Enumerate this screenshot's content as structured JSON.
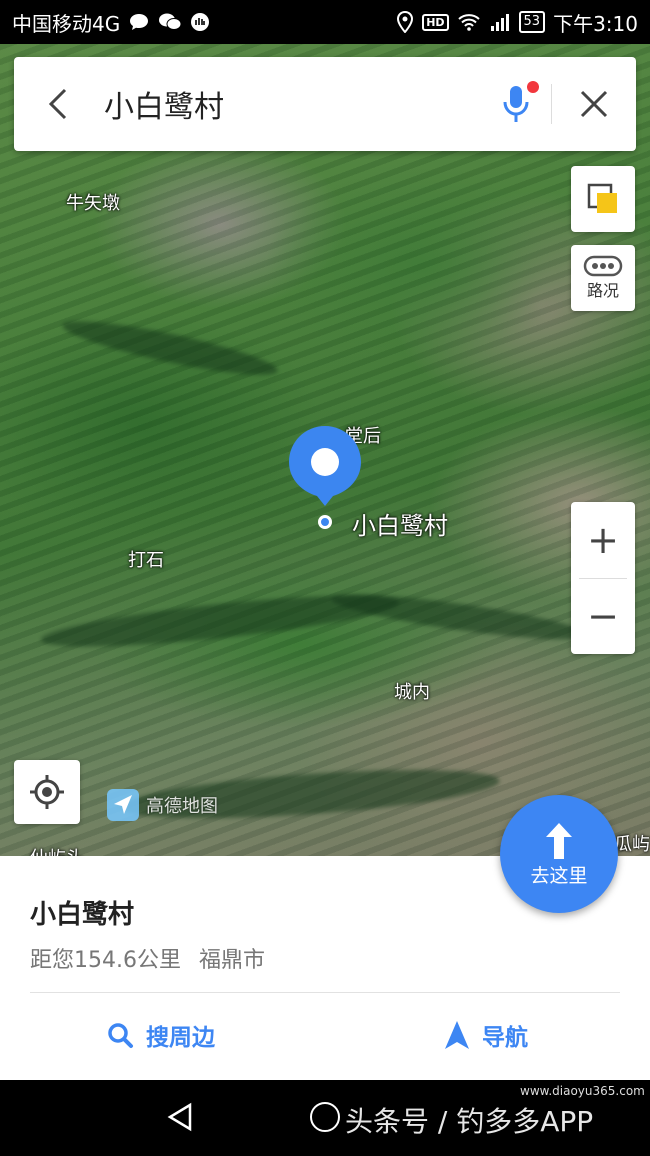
{
  "status_bar": {
    "carrier": "中国移动4G",
    "hd": "HD",
    "battery": "53",
    "time": "下午3:10"
  },
  "search": {
    "query": "小白鹭村"
  },
  "map_controls": {
    "traffic_label": "路况",
    "zoom_in": "+",
    "zoom_out": "−"
  },
  "map_labels": {
    "niu_shi_dun": "牛矢墩",
    "tang_hou": "堂后",
    "village": "小白鹭村",
    "da_shi": "打石",
    "cheng_nei": "城内",
    "gua": "瓜屿",
    "bottom_left": "仙屿头"
  },
  "logo": {
    "text": "高德地图"
  },
  "go_button": {
    "label": "去这里"
  },
  "place_card": {
    "name": "小白鹭村",
    "distance": "距您154.6公里",
    "city": "福鼎市",
    "nearby_label": "搜周边",
    "navigate_label": "导航"
  },
  "nav_bar": {
    "watermark": "头条号 / 钓多多APP",
    "watermark_url": "www.diaoyu365.com"
  },
  "colors": {
    "accent": "#3d86f3",
    "pin": "#3c86f0",
    "mic_dot": "#f2373d"
  }
}
